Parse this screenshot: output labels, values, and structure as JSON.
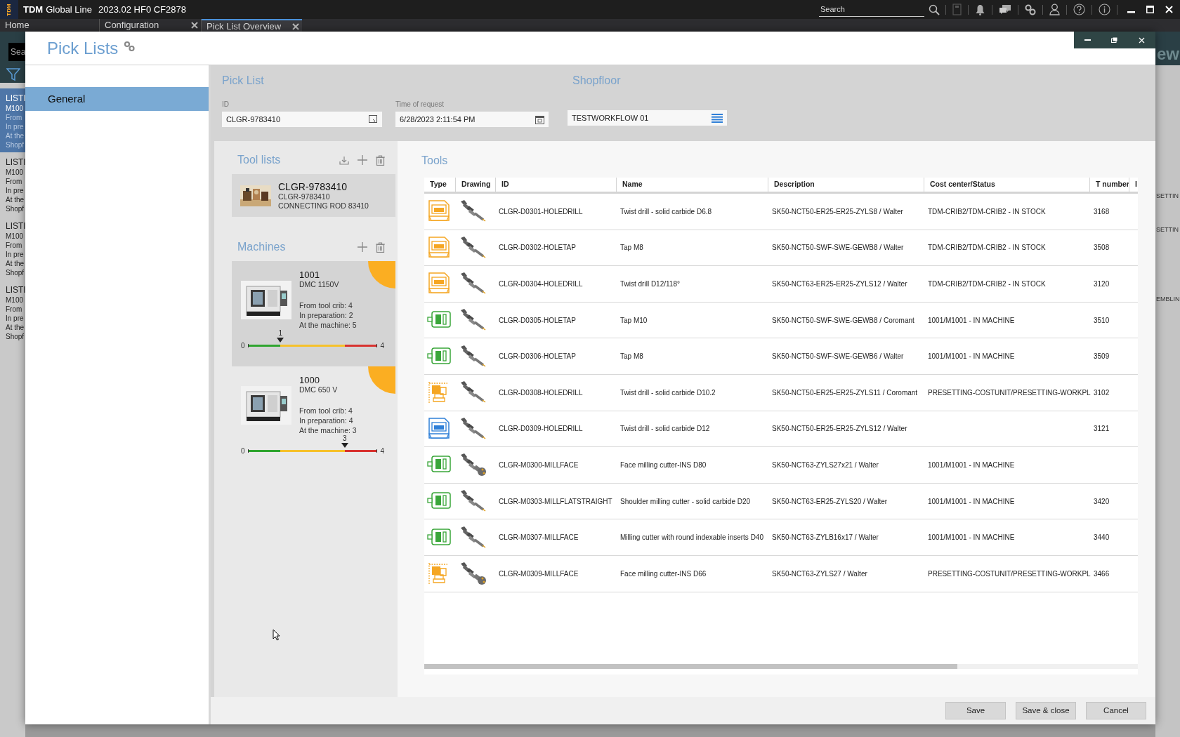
{
  "app_bar": {
    "logo_text": "TDM",
    "brand": "TDM",
    "product": "Global Line",
    "version": "2023.02 HF0 CF2878",
    "search_placeholder": "Search"
  },
  "tabs": [
    {
      "label": "Home",
      "closable": false,
      "selected": false
    },
    {
      "label": "Configuration",
      "closable": true,
      "selected": false
    },
    {
      "label": "Pick List Overview",
      "closable": true,
      "selected": true
    }
  ],
  "background_list": {
    "search_placeholder": "Sea",
    "items": [
      {
        "lines": [
          "LISTI",
          "M100",
          "From",
          "In pre",
          "At the",
          "Shopf"
        ],
        "selected": true
      },
      {
        "lines": [
          "LISTI",
          "M100",
          "From",
          "In pre",
          "At the",
          "Shopf"
        ],
        "selected": false
      },
      {
        "lines": [
          "LISTI",
          "M100",
          "From",
          "In pre",
          "At the",
          "Shopf"
        ],
        "selected": false
      },
      {
        "lines": [
          "LISTI",
          "M100",
          "From",
          "In pre",
          "At the",
          "Shopf"
        ],
        "selected": false
      }
    ]
  },
  "background_right": {
    "heading": "ew",
    "labels": [
      "SETTIN",
      "SETTIN",
      "EMBLIN"
    ]
  },
  "dialog": {
    "title": "Pick Lists",
    "nav": [
      {
        "label": "General",
        "selected": true
      }
    ],
    "pick_list": {
      "heading": "Pick List",
      "id_label": "ID",
      "id_value": "CLGR-9783410",
      "time_label": "Time of request",
      "time_value": "6/28/2023 2:11:54 PM"
    },
    "shopfloor": {
      "heading": "Shopfloor",
      "value": "TESTWORKFLOW 01"
    },
    "tool_lists": {
      "heading": "Tool lists",
      "items": [
        {
          "title": "CLGR-9783410",
          "id": "CLGR-9783410",
          "description": "CONNECTING ROD 83410"
        }
      ]
    },
    "machines": {
      "heading": "Machines",
      "items": [
        {
          "number": "1001",
          "model": "DMC 1150V",
          "counts": [
            "From tool crib: 4",
            "In preparation: 2",
            "At the machine: 5"
          ],
          "selected": true,
          "gauge_min": "0",
          "gauge_max": "4",
          "marker_label": "1",
          "level": 0.25
        },
        {
          "number": "1000",
          "model": "DMC 650 V",
          "counts": [
            "From tool crib: 4",
            "In preparation: 4",
            "At the machine: 3"
          ],
          "selected": false,
          "gauge_min": "0",
          "gauge_max": "4",
          "marker_label": "3",
          "level": 0.75
        }
      ]
    },
    "tools": {
      "heading": "Tools",
      "columns": [
        "Type",
        "Drawing",
        "ID",
        "Name",
        "Description",
        "Cost center/Status",
        "T number",
        "I"
      ],
      "rows": [
        {
          "type": {
            "kind": "cabinet",
            "color": "#f5a623"
          },
          "drawing": {
            "kind": "drill"
          },
          "id": "CLGR-D0301-HOLEDRILL",
          "name": "Twist drill - solid carbide D6.8",
          "description": "SK50-NCT50-ER25-ER25-ZYLS8 / Walter",
          "cost_center": "TDM-CRIB2/TDM-CRIB2 - IN STOCK",
          "t_number": "3168"
        },
        {
          "type": {
            "kind": "cabinet",
            "color": "#f5a623"
          },
          "drawing": {
            "kind": "drill"
          },
          "id": "CLGR-D0302-HOLETAP",
          "name": "Tap M8",
          "description": "SK50-NCT50-SWF-SWE-GEWB8 / Walter",
          "cost_center": "TDM-CRIB2/TDM-CRIB2 - IN STOCK",
          "t_number": "3508"
        },
        {
          "type": {
            "kind": "cabinet",
            "color": "#f5a623"
          },
          "drawing": {
            "kind": "drill"
          },
          "id": "CLGR-D0304-HOLEDRILL",
          "name": "Twist drill D12/118°",
          "description": "SK50-NCT63-ER25-ER25-ZYLS12 / Walter",
          "cost_center": "TDM-CRIB2/TDM-CRIB2 - IN STOCK",
          "t_number": "3120"
        },
        {
          "type": {
            "kind": "machine",
            "color": "#3aa63a"
          },
          "drawing": {
            "kind": "drill"
          },
          "id": "CLGR-D0305-HOLETAP",
          "name": "Tap M10",
          "description": "SK50-NCT50-SWF-SWE-GEWB8 / Coromant",
          "cost_center": "1001/M1001 - IN MACHINE",
          "t_number": "3510"
        },
        {
          "type": {
            "kind": "machine",
            "color": "#3aa63a"
          },
          "drawing": {
            "kind": "drill"
          },
          "id": "CLGR-D0306-HOLETAP",
          "name": "Tap M8",
          "description": "SK50-NCT50-SWF-SWE-GEWB6 / Walter",
          "cost_center": "1001/M1001 - IN MACHINE",
          "t_number": "3509"
        },
        {
          "type": {
            "kind": "presetting",
            "color": "#f5a623"
          },
          "drawing": {
            "kind": "drill"
          },
          "id": "CLGR-D0308-HOLEDRILL",
          "name": "Twist drill - solid carbide D10.2",
          "description": "SK50-NCT50-ER25-ER25-ZYLS11 / Coromant",
          "cost_center": "PRESETTING-COSTUNIT/PRESETTING-WORKPL",
          "t_number": "3102"
        },
        {
          "type": {
            "kind": "cabinet",
            "color": "#2f80d8"
          },
          "drawing": {
            "kind": "drill"
          },
          "id": "CLGR-D0309-HOLEDRILL",
          "name": "Twist drill - solid carbide D12",
          "description": "SK50-NCT50-ER25-ER25-ZYLS12 / Walter",
          "t_number": "3121"
        },
        {
          "type": {
            "kind": "machine",
            "color": "#3aa63a"
          },
          "drawing": {
            "kind": "mill"
          },
          "id": "CLGR-M0300-MILLFACE",
          "name": "Face milling cutter-INS D80",
          "description": "SK50-NCT63-ZYLS27x21 / Walter",
          "cost_center": "1001/M1001 - IN MACHINE"
        },
        {
          "type": {
            "kind": "machine",
            "color": "#3aa63a"
          },
          "drawing": {
            "kind": "drill"
          },
          "id": "CLGR-M0303-MILLFLATSTRAIGHT",
          "name": "Shoulder milling cutter - solid carbide D20",
          "description": "SK50-NCT63-ER25-ZYLS20 / Walter",
          "cost_center": "1001/M1001 - IN MACHINE",
          "t_number": "3420"
        },
        {
          "type": {
            "kind": "machine",
            "color": "#3aa63a"
          },
          "drawing": {
            "kind": "drill"
          },
          "id": "CLGR-M0307-MILLFACE",
          "name": "Milling cutter with round indexable inserts D40",
          "description": "SK50-NCT63-ZYLB16x17 / Walter",
          "cost_center": "1001/M1001 - IN MACHINE",
          "t_number": "3440"
        },
        {
          "type": {
            "kind": "presetting",
            "color": "#f5a623"
          },
          "drawing": {
            "kind": "mill"
          },
          "id": "CLGR-M0309-MILLFACE",
          "name": "Face milling cutter-INS D66",
          "description": "SK50-NCT63-ZYLS27 / Walter",
          "cost_center": "PRESETTING-COSTUNIT/PRESETTING-WORKPL",
          "t_number": "3466"
        }
      ]
    },
    "buttons": [
      "Save",
      "Save & close",
      "Cancel"
    ]
  }
}
